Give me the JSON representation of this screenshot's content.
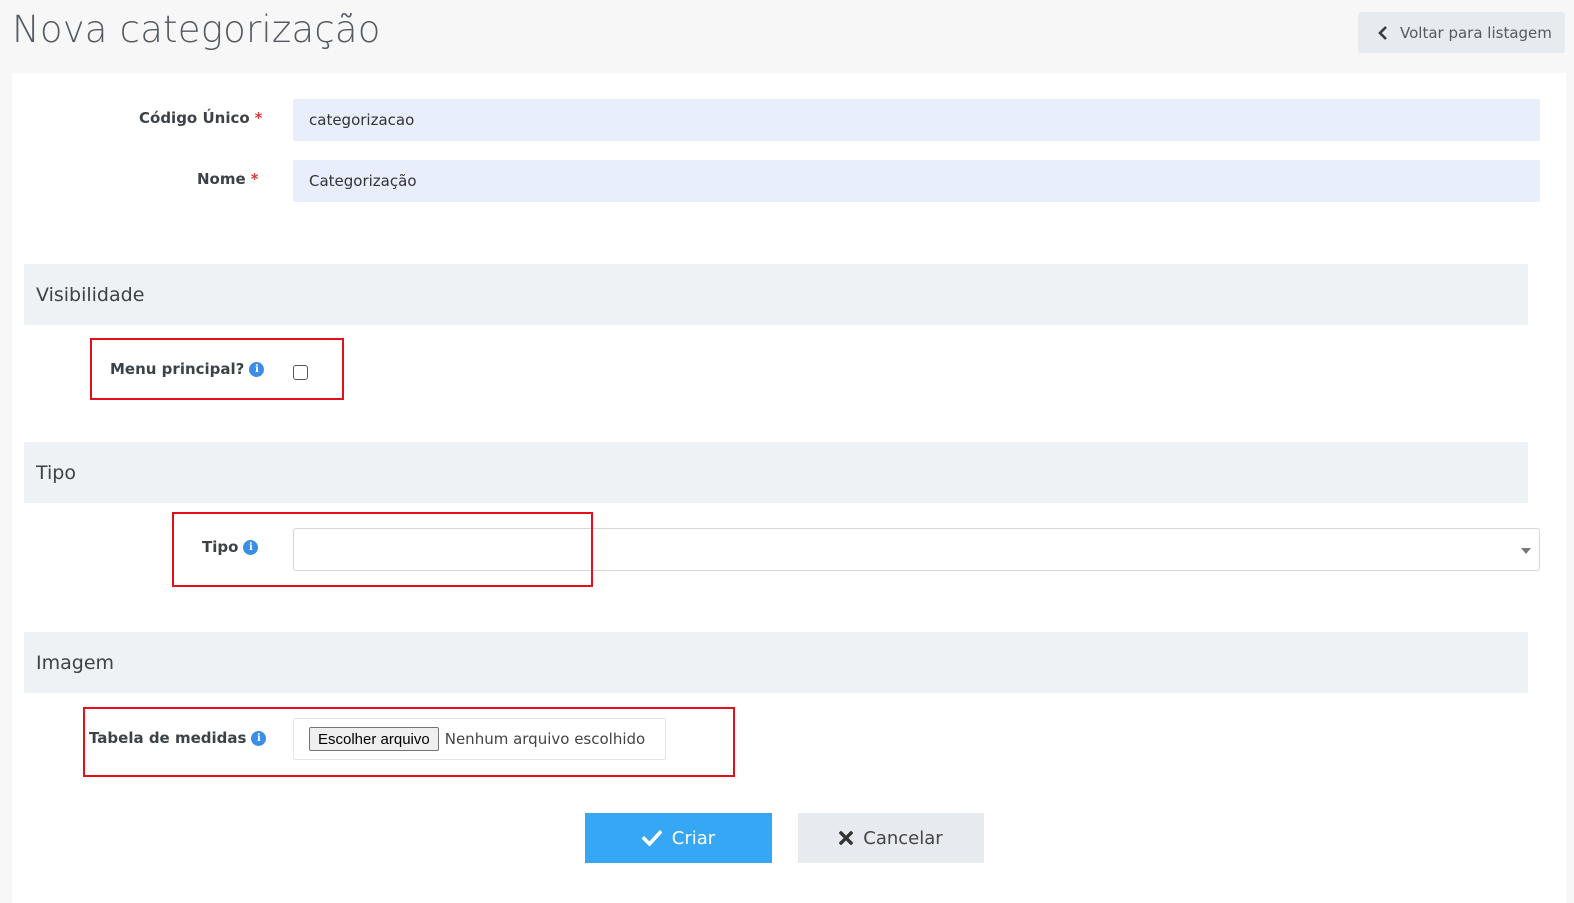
{
  "header": {
    "title": "Nova categorização",
    "back_label": "Voltar para listagem"
  },
  "form": {
    "codigo": {
      "label": "Código Único",
      "required_mark": "*",
      "value": "categorizacao"
    },
    "nome": {
      "label": "Nome",
      "required_mark": "*",
      "value": "Categorização"
    }
  },
  "sections": {
    "visibilidade": {
      "title": "Visibilidade",
      "menu_principal": {
        "label": "Menu principal?",
        "checked": false
      }
    },
    "tipo": {
      "title": "Tipo",
      "field": {
        "label": "Tipo",
        "selected": ""
      }
    },
    "imagem": {
      "title": "Imagem",
      "tabela": {
        "label": "Tabela de medidas",
        "button": "Escolher arquivo",
        "status": "Nenhum arquivo escolhido"
      }
    }
  },
  "info_glyph": "i",
  "actions": {
    "create": "Criar",
    "cancel": "Cancelar"
  },
  "colors": {
    "accent": "#36a7f5",
    "input_bg": "#e8eefb",
    "highlight": "#e3101c",
    "required": "#e03a3a",
    "info": "#3a8ee6"
  }
}
